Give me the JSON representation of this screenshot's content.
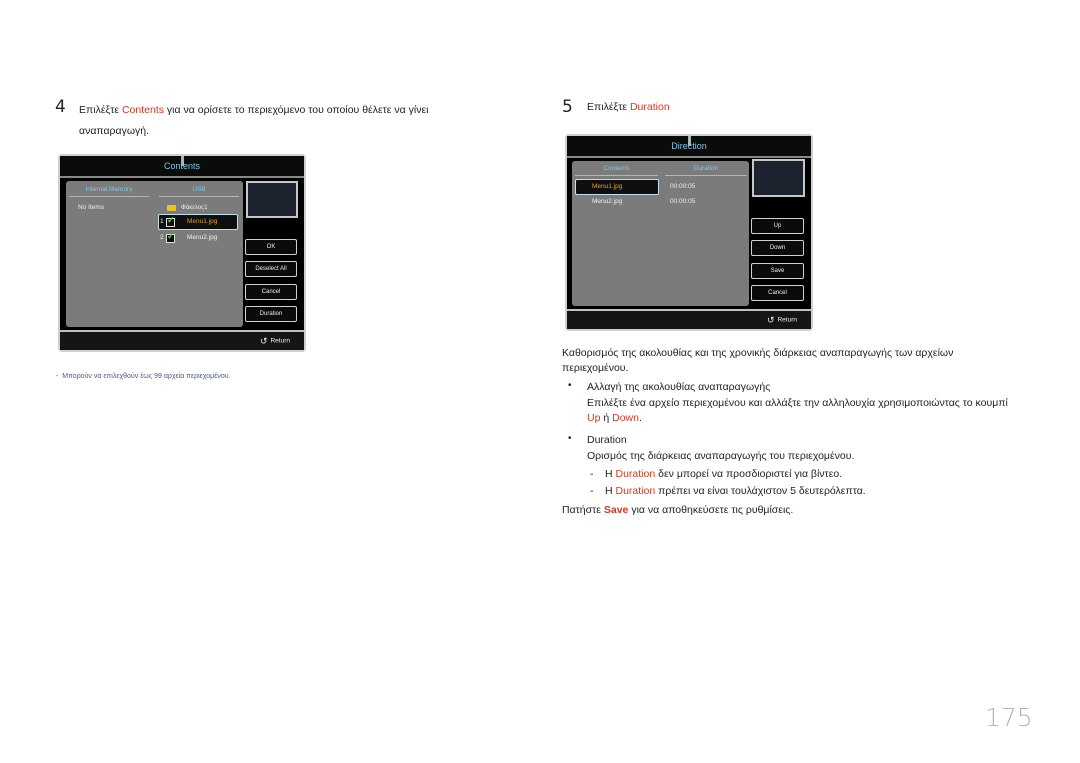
{
  "step4": {
    "number": "4",
    "text_before": "Επιλέξτε ",
    "highlight": "Contents",
    "text_after": " για να ορίσετε το περιεχόμενο του οποίου θέλετε να γίνει αναπαραγωγή."
  },
  "contents_dialog": {
    "title": "Contents",
    "columns": [
      "Internal Memory",
      "USB"
    ],
    "internal_memory_empty": "No Items",
    "usb_items": [
      {
        "type": "folder",
        "label": "Φάκελος1"
      },
      {
        "type": "file",
        "index": "1",
        "label": "Menu1.jpg",
        "checked": true,
        "selected": true
      },
      {
        "type": "file",
        "index": "2",
        "label": "Menu2.jpg",
        "checked": true,
        "selected": false
      }
    ],
    "buttons": [
      "OK",
      "Deselect All",
      "Cancel",
      "Duration"
    ],
    "return_label": "Return"
  },
  "note": {
    "dash": "-",
    "text": "Μπορούν να επιλεχθούν έως 99 αρχεία περιεχομένου."
  },
  "step5": {
    "number": "5",
    "text_before": "Επιλέξτε ",
    "highlight": "Duration"
  },
  "duration_dialog": {
    "title": "Direction",
    "columns": [
      "Contents",
      "Duration"
    ],
    "rows": [
      {
        "file": "Menu1.jpg",
        "duration": "00:00:05",
        "selected": true
      },
      {
        "file": "Menu2.jpg",
        "duration": "00:00:05",
        "selected": false
      }
    ],
    "buttons": [
      "Up",
      "Down",
      "Save",
      "Cancel"
    ],
    "return_label": "Return"
  },
  "description": {
    "intro": "Καθορισμός της ακολουθίας και της χρονικής διάρκειας αναπαραγωγής των αρχείων περιεχομένου.",
    "bullet1_title": "Αλλαγή της ακολουθίας αναπαραγωγής",
    "bullet1_text_before": "Επιλέξτε ένα αρχείο περιεχομένου και αλλάξτε την αλληλουχία χρησιμοποιώντας το κουμπί ",
    "bullet1_up": "Up",
    "bullet1_or": " ή ",
    "bullet1_down": "Down",
    "bullet1_end": ".",
    "bullet2_title": "Duration",
    "bullet2_text": "Ορισμός της διάρκειας αναπαραγωγής του περιεχομένου.",
    "sub1_before": "Η ",
    "sub1_highlight": "Duration",
    "sub1_after": " δεν μπορεί να προσδιοριστεί για βίντεο.",
    "sub2_before": "Η ",
    "sub2_highlight": "Duration",
    "sub2_after": " πρέπει να είναι τουλάχιστον 5 δευτερόλεπτα.",
    "final_before": "Πατήστε ",
    "final_highlight": "Save",
    "final_after": " για να αποθηκεύσετε τις ρυθμίσεις."
  },
  "page_number": "175",
  "colors": {
    "accent_red": "#d7381e",
    "dialog_title": "#7fc8e8",
    "selected_text": "#e0a31a",
    "check_green": "#5ed63a"
  }
}
